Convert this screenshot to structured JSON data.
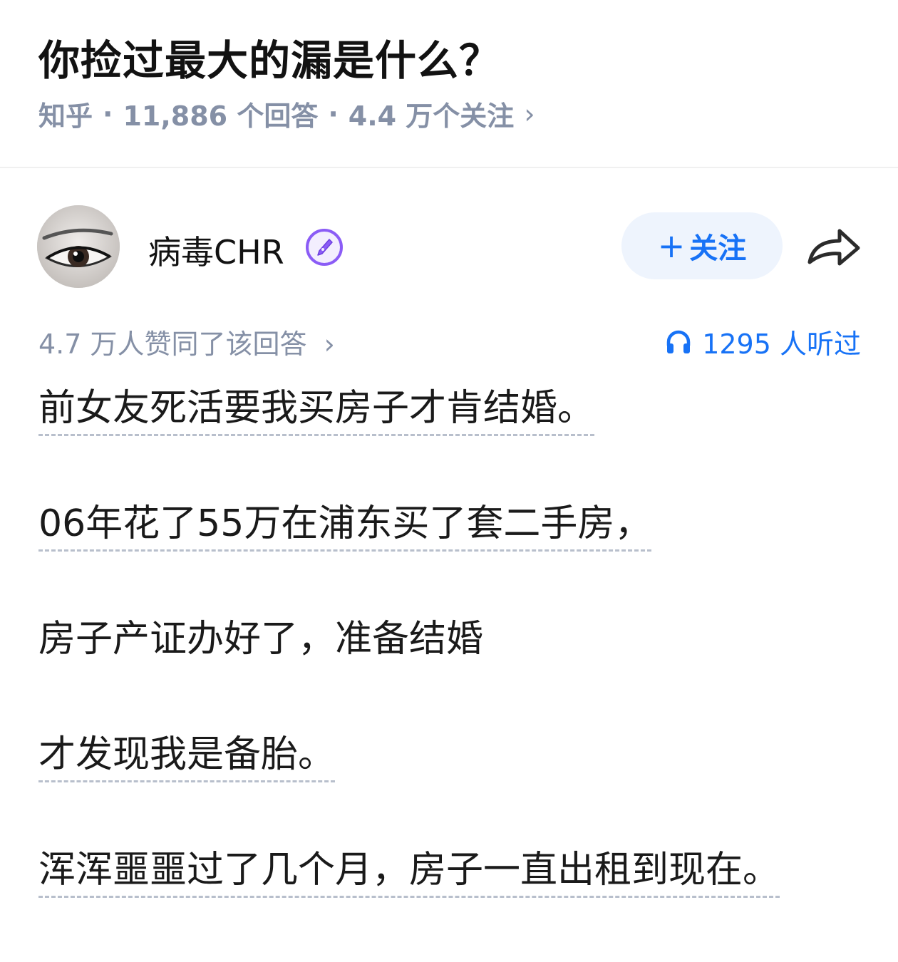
{
  "question": {
    "title": "你捡过最大的漏是什么？",
    "source": "知乎",
    "separator": "·",
    "answers": "11,886 个回答",
    "followers": "4.4 万个关注",
    "chevron": "›"
  },
  "author": {
    "name": "病毒CHR",
    "avatar_icon": "avatar-eye-image",
    "badge_icon": "pen-badge-icon",
    "follow_label": "关注",
    "follow_plus": "+",
    "share_icon": "share-arrow-icon"
  },
  "stats": {
    "upvotes": "4.7 万人赞同了该回答",
    "upvotes_chevron": "›",
    "listen_icon": "headphone-icon",
    "listens": "1295 人听过"
  },
  "answer": {
    "paragraphs": [
      "前女友死活要我买房子才肯结婚。",
      "06年花了55万在浦东买了套二手房，",
      "房子产证办好了，准备结婚",
      "才发现我是备胎。",
      "浑浑噩噩过了几个月，房子一直出租到现在。"
    ]
  },
  "colors": {
    "accent": "#1772f6",
    "meta_gray": "#8590a6",
    "follow_bg": "#eef4fd",
    "badge_purple": "#8b5cf6"
  }
}
